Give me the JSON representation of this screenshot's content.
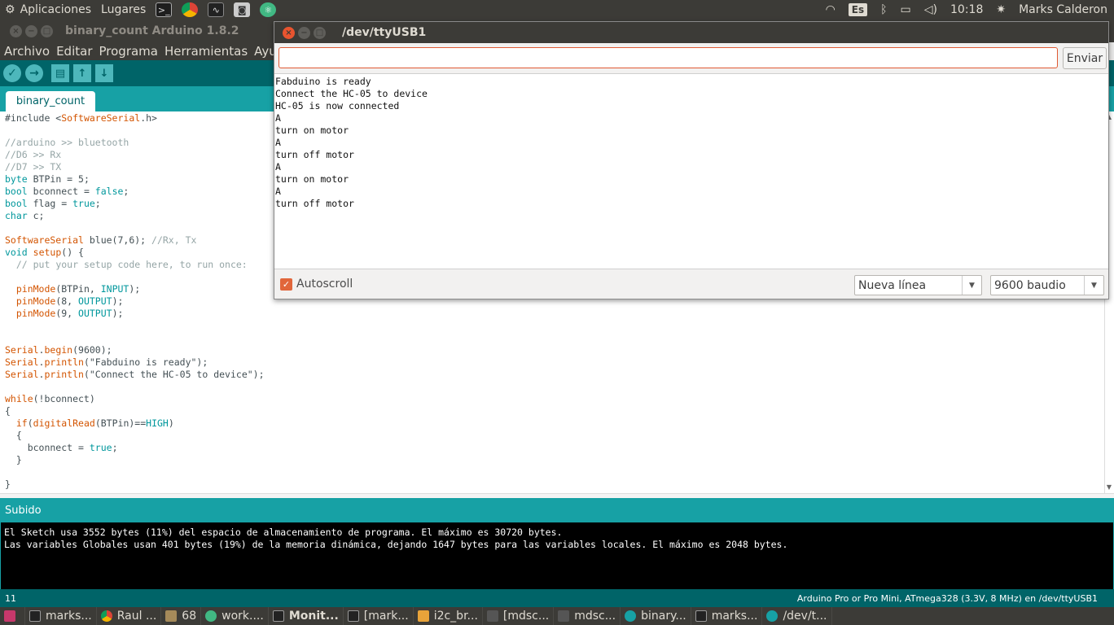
{
  "top_panel": {
    "menu_apps": "Aplicaciones",
    "menu_places": "Lugares",
    "keyboard_layout": "Es",
    "clock": "10:18",
    "user": "Marks Calderon"
  },
  "arduino": {
    "title": "binary_count Arduino 1.8.2",
    "menu": [
      "Archivo",
      "Editar",
      "Programa",
      "Herramientas",
      "Ayuda"
    ],
    "tab": "binary_count",
    "code": [
      "#include <SoftwareSerial.h>",
      "",
      "//arduino >> bluetooth",
      "//D6 >> Rx",
      "//D7 >> TX",
      "byte BTPin = 5;",
      "bool bconnect = false;",
      "bool flag = true;",
      "char c;",
      "",
      "SoftwareSerial blue(7,6); //Rx, Tx",
      "void setup() {",
      "  // put your setup code here, to run once:",
      "",
      "  pinMode(BTPin, INPUT);",
      "  pinMode(8, OUTPUT);",
      "  pinMode(9, OUTPUT);",
      "",
      "",
      "Serial.begin(9600);",
      "Serial.println(\"Fabduino is ready\");",
      "Serial.println(\"Connect the HC-05 to device\");",
      "",
      "while(!bconnect)",
      "{",
      "  if(digitalRead(BTPin)==HIGH)",
      "  {",
      "    bconnect = true;",
      "  }",
      "",
      "}"
    ],
    "status": "Subido",
    "console": [
      "El Sketch usa 3552 bytes (11%) del espacio de almacenamiento de programa. El máximo es 30720 bytes.",
      "Las variables Globales usan 401 bytes (19%) de la memoria dinámica, dejando 1647 bytes para las variables locales. El máximo es 2048 bytes."
    ],
    "line_number": "11",
    "board_info": "Arduino Pro or Pro Mini, ATmega328 (3.3V, 8 MHz) en /dev/ttyUSB1"
  },
  "serial_monitor": {
    "title": "/dev/ttyUSB1",
    "input_value": "",
    "send_label": "Enviar",
    "output": [
      "Fabduino is ready",
      "Connect the HC-05 to device",
      "HC-05 is now connected",
      "A",
      "turn on motor",
      "A",
      "turn off motor",
      "A",
      "turn on motor",
      "A",
      "turn off motor"
    ],
    "autoscroll_label": "Autoscroll",
    "autoscroll_checked": true,
    "line_ending": "Nueva línea",
    "baud": "9600 baudio"
  },
  "taskbar": [
    {
      "label": "marks...",
      "icon": "terminal-icon"
    },
    {
      "label": "Raul ...",
      "icon": "chrome-icon"
    },
    {
      "label": "68",
      "icon": "calculator-icon"
    },
    {
      "label": "work....",
      "icon": "green-app-icon"
    },
    {
      "label": "Monit...",
      "icon": "system-monitor-icon"
    },
    {
      "label": "[mark...",
      "icon": "terminal-icon"
    },
    {
      "label": "i2c_br...",
      "icon": "editor-icon"
    },
    {
      "label": "[mdsc...",
      "icon": "document-icon"
    },
    {
      "label": "mdsc...",
      "icon": "document-icon"
    },
    {
      "label": "binary...",
      "icon": "arduino-icon"
    },
    {
      "label": "marks...",
      "icon": "terminal-icon"
    },
    {
      "label": "/dev/t...",
      "icon": "arduino-icon"
    }
  ],
  "colors": {
    "arduino_teal": "#17a1a5",
    "arduino_dark": "#006468",
    "ubuntu_panel": "#3c3b37",
    "close_orange": "#e8542f"
  }
}
